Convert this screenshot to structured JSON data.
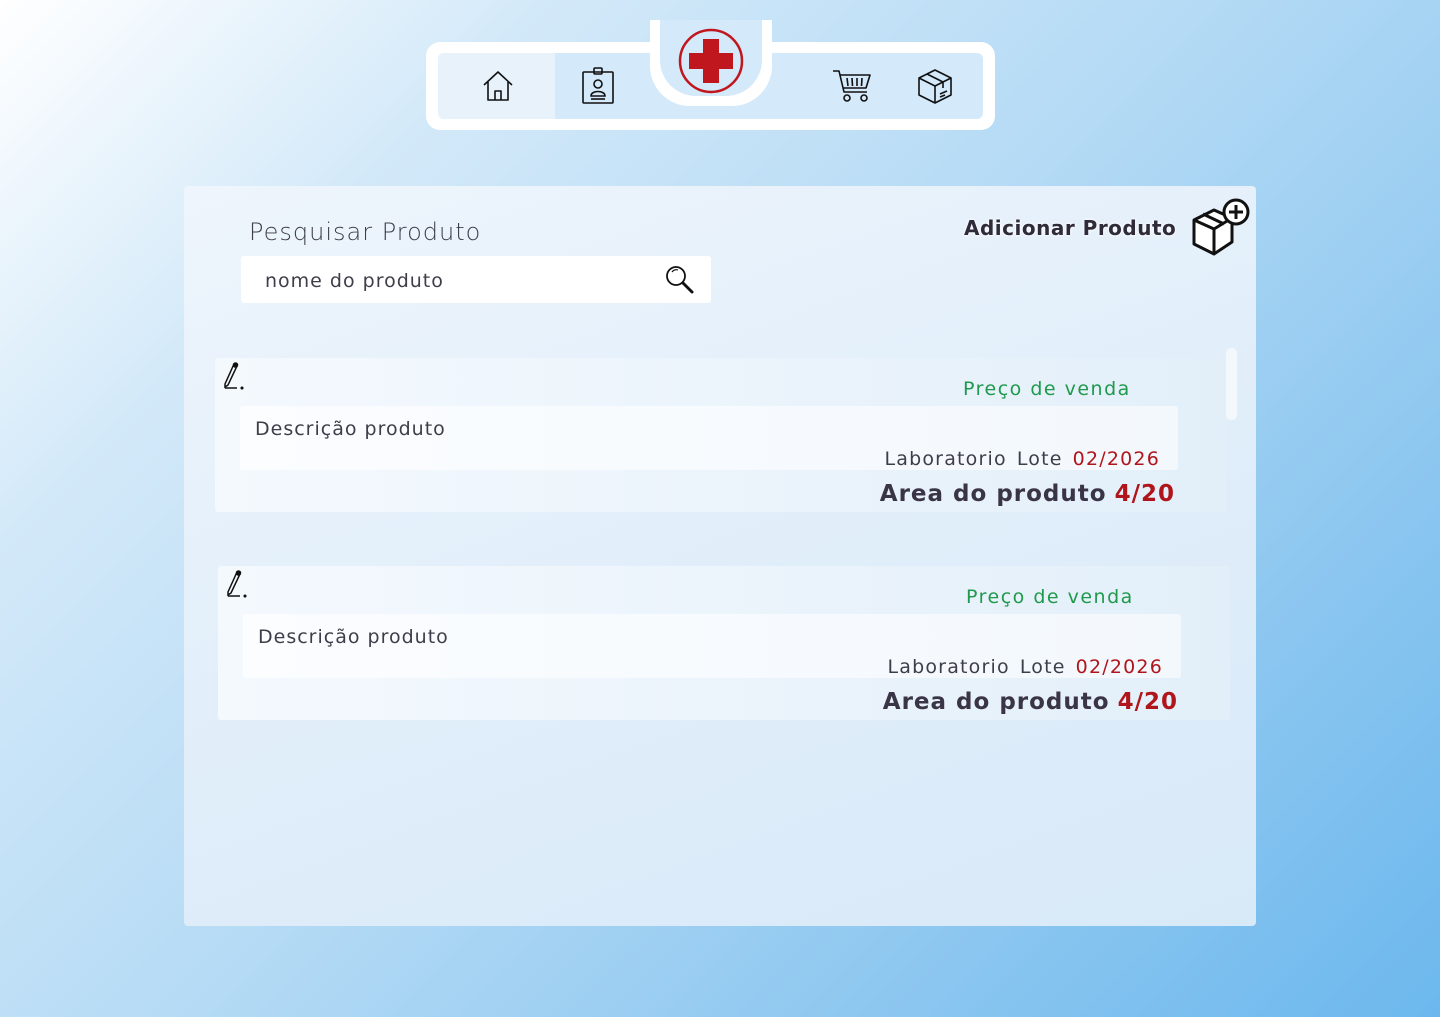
{
  "nav": {
    "items": [
      {
        "icon": "home-icon"
      },
      {
        "icon": "id-badge-icon"
      },
      {
        "icon": "shopping-cart-icon"
      },
      {
        "icon": "package-icon"
      }
    ],
    "logo_icon": "red-cross-icon"
  },
  "search": {
    "title": "Pesquisar Produto",
    "placeholder": "nome do produto",
    "icon": "search-icon"
  },
  "add_product": {
    "label": "Adicionar Produto",
    "icon": "package-add-icon"
  },
  "products": [
    {
      "price_label": "Preço de venda",
      "description": "Descrição produto",
      "laboratory": "Laboratorio",
      "lot": "Lote",
      "lot_date": "02/2026",
      "area_label": "Area do produto",
      "area_count": "4/20"
    },
    {
      "price_label": "Preço de venda",
      "description": "Descrição produto",
      "laboratory": "Laboratorio",
      "lot": "Lote",
      "lot_date": "02/2026",
      "area_label": "Area do produto",
      "area_count": "4/20"
    }
  ],
  "colors": {
    "accent_red": "#b0151b",
    "price_green": "#1f9a4c",
    "text_dark": "#3e3e4a"
  }
}
